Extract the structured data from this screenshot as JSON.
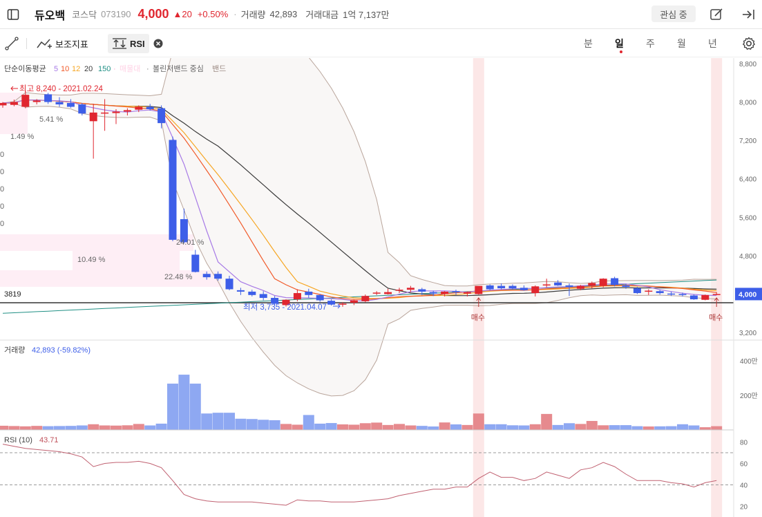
{
  "header": {
    "stock_name": "듀오백",
    "market": "코스닥",
    "code": "073190",
    "price": "4,000",
    "change": "▲20",
    "change_pct": "+0.50%",
    "separator": "·",
    "volume_label": "거래량",
    "volume": "42,893",
    "amount_label": "거래대금",
    "amount": "1억 7,137만",
    "watch_button": "관심 중"
  },
  "toolbar": {
    "indicator_label": "보조지표",
    "rsi_label": "RSI",
    "periods": [
      "분",
      "일",
      "주",
      "월",
      "년"
    ],
    "active_period": "일"
  },
  "colors": {
    "up": "#e0262f",
    "down": "#3d5ee8",
    "ma5": "#a77ae6",
    "ma10": "#f15a29",
    "ma12": "#f6a623",
    "ma20": "#3a3a3a",
    "ma150": "#1f8f84",
    "bollinger": "#b9a59b",
    "signal_band": "#fbe3e3"
  },
  "legend": {
    "title": "단순이동평균",
    "periods": [
      "5",
      "10",
      "12",
      "20",
      "150"
    ],
    "hidden_item": "매물대",
    "dot": "·",
    "bollinger": "볼린저밴드 중심",
    "band": "밴드"
  },
  "annotations": {
    "high": "최고 8,240 - 2021.02.24",
    "low": "최저 3,735 - 2021.04.07",
    "reference_price": "3819",
    "buy_label": "매수",
    "current_price": "4,000",
    "pct_labels": [
      "5.41 %",
      "1.49 %",
      "10.49 %",
      "24.01 %",
      "22.48 %"
    ],
    "partial_labels": [
      "0",
      "0",
      "0",
      "0",
      "0"
    ]
  },
  "volume_panel": {
    "title": "거래량",
    "value": "42,893 (-59.82%)",
    "ticks": [
      "400만",
      "200만"
    ]
  },
  "rsi_panel": {
    "title": "RSI (10)",
    "value": "43.71",
    "ticks": [
      "80",
      "60",
      "40",
      "20"
    ]
  },
  "chart_data": {
    "type": "candlestick",
    "price_axis": {
      "ticks": [
        8800,
        8000,
        7200,
        6400,
        5600,
        4800,
        4000,
        3200
      ],
      "tick_labels": [
        "8,800",
        "8,000",
        "7,200",
        "6,400",
        "5,600",
        "4,800",
        "4,000",
        "3,200"
      ],
      "range": [
        3200,
        8800
      ]
    },
    "volume_axis": {
      "range": [
        0,
        5000000
      ]
    },
    "rsi_axis": {
      "range": [
        10,
        90
      ],
      "dashed_levels": [
        70,
        40
      ]
    },
    "buy_signal_indices": [
      42,
      63
    ],
    "candles": [
      {
        "o": 7930,
        "h": 8000,
        "l": 7880,
        "c": 7980
      },
      {
        "o": 7940,
        "h": 8050,
        "l": 7910,
        "c": 8000
      },
      {
        "o": 7900,
        "h": 8240,
        "l": 7870,
        "c": 8150
      },
      {
        "o": 8000,
        "h": 8060,
        "l": 7950,
        "c": 8030
      },
      {
        "o": 8160,
        "h": 8190,
        "l": 7960,
        "c": 8000
      },
      {
        "o": 8000,
        "h": 8100,
        "l": 7900,
        "c": 7950
      },
      {
        "o": 7980,
        "h": 8060,
        "l": 7880,
        "c": 7900
      },
      {
        "o": 7950,
        "h": 7980,
        "l": 7720,
        "c": 7760
      },
      {
        "o": 7600,
        "h": 7960,
        "l": 6820,
        "c": 7780
      },
      {
        "o": 7770,
        "h": 8060,
        "l": 7400,
        "c": 7780
      },
      {
        "o": 7770,
        "h": 7850,
        "l": 7540,
        "c": 7800
      },
      {
        "o": 7800,
        "h": 7870,
        "l": 7720,
        "c": 7830
      },
      {
        "o": 7840,
        "h": 7930,
        "l": 7790,
        "c": 7900
      },
      {
        "o": 7900,
        "h": 7960,
        "l": 7820,
        "c": 7850
      },
      {
        "o": 7870,
        "h": 7930,
        "l": 7450,
        "c": 7560
      },
      {
        "o": 7210,
        "h": 7280,
        "l": 5100,
        "c": 5130
      },
      {
        "o": 5560,
        "h": 5780,
        "l": 5060,
        "c": 5080
      },
      {
        "o": 4820,
        "h": 4920,
        "l": 4450,
        "c": 4460
      },
      {
        "o": 4420,
        "h": 4470,
        "l": 4300,
        "c": 4350
      },
      {
        "o": 4420,
        "h": 4470,
        "l": 4280,
        "c": 4320
      },
      {
        "o": 4320,
        "h": 4380,
        "l": 4080,
        "c": 4100
      },
      {
        "o": 4080,
        "h": 4130,
        "l": 3980,
        "c": 4050
      },
      {
        "o": 4050,
        "h": 4090,
        "l": 3950,
        "c": 3980
      },
      {
        "o": 4000,
        "h": 4060,
        "l": 3870,
        "c": 3920
      },
      {
        "o": 3920,
        "h": 3960,
        "l": 3780,
        "c": 3800
      },
      {
        "o": 3770,
        "h": 3890,
        "l": 3740,
        "c": 3880
      },
      {
        "o": 3890,
        "h": 4100,
        "l": 3850,
        "c": 4020
      },
      {
        "o": 4050,
        "h": 4110,
        "l": 3920,
        "c": 3980
      },
      {
        "o": 3980,
        "h": 4000,
        "l": 3840,
        "c": 3870
      },
      {
        "o": 3860,
        "h": 3890,
        "l": 3760,
        "c": 3780
      },
      {
        "o": 3790,
        "h": 3830,
        "l": 3735,
        "c": 3800
      },
      {
        "o": 3820,
        "h": 3880,
        "l": 3770,
        "c": 3870
      },
      {
        "o": 3850,
        "h": 3990,
        "l": 3830,
        "c": 3960
      },
      {
        "o": 4010,
        "h": 4060,
        "l": 3980,
        "c": 4030
      },
      {
        "o": 4000,
        "h": 4110,
        "l": 3990,
        "c": 4040
      },
      {
        "o": 4070,
        "h": 4130,
        "l": 4020,
        "c": 4090
      },
      {
        "o": 4090,
        "h": 4170,
        "l": 4040,
        "c": 4130
      },
      {
        "o": 4100,
        "h": 4130,
        "l": 3980,
        "c": 4050
      },
      {
        "o": 4040,
        "h": 4070,
        "l": 3960,
        "c": 4010
      },
      {
        "o": 4000,
        "h": 4060,
        "l": 3950,
        "c": 4050
      },
      {
        "o": 4060,
        "h": 4090,
        "l": 3980,
        "c": 4040
      },
      {
        "o": 4010,
        "h": 4050,
        "l": 3950,
        "c": 4040
      },
      {
        "o": 4000,
        "h": 4130,
        "l": 3990,
        "c": 4170
      },
      {
        "o": 4180,
        "h": 4200,
        "l": 4080,
        "c": 4100
      },
      {
        "o": 4170,
        "h": 4220,
        "l": 4100,
        "c": 4120
      },
      {
        "o": 4170,
        "h": 4200,
        "l": 4100,
        "c": 4120
      },
      {
        "o": 4130,
        "h": 4180,
        "l": 4070,
        "c": 4080
      },
      {
        "o": 4020,
        "h": 4180,
        "l": 3950,
        "c": 4160
      },
      {
        "o": 4180,
        "h": 4320,
        "l": 4140,
        "c": 4200
      },
      {
        "o": 4240,
        "h": 4290,
        "l": 4170,
        "c": 4180
      },
      {
        "o": 4180,
        "h": 4220,
        "l": 3960,
        "c": 4150
      },
      {
        "o": 4110,
        "h": 4190,
        "l": 4080,
        "c": 4170
      },
      {
        "o": 4170,
        "h": 4260,
        "l": 4120,
        "c": 4230
      },
      {
        "o": 4170,
        "h": 4330,
        "l": 4140,
        "c": 4320
      },
      {
        "o": 4330,
        "h": 4360,
        "l": 4160,
        "c": 4190
      },
      {
        "o": 4180,
        "h": 4210,
        "l": 4110,
        "c": 4150
      },
      {
        "o": 4120,
        "h": 4150,
        "l": 4000,
        "c": 4020
      },
      {
        "o": 4050,
        "h": 4100,
        "l": 3980,
        "c": 4070
      },
      {
        "o": 4060,
        "h": 4090,
        "l": 3990,
        "c": 4020
      },
      {
        "o": 4010,
        "h": 4050,
        "l": 3960,
        "c": 4000
      },
      {
        "o": 4000,
        "h": 4030,
        "l": 3950,
        "c": 3980
      },
      {
        "o": 3970,
        "h": 3990,
        "l": 3880,
        "c": 3890
      },
      {
        "o": 3880,
        "h": 3990,
        "l": 3870,
        "c": 3980
      },
      {
        "o": 3990,
        "h": 4040,
        "l": 3980,
        "c": 4000
      }
    ],
    "volume": [
      280,
      260,
      240,
      270,
      250,
      260,
      270,
      300,
      380,
      300,
      290,
      310,
      400,
      300,
      420,
      3100,
      3700,
      3100,
      1100,
      1150,
      1150,
      750,
      730,
      680,
      650,
      400,
      350,
      1000,
      420,
      460,
      370,
      350,
      450,
      490,
      330,
      400,
      300,
      270,
      230,
      500,
      370,
      330,
      1100,
      380,
      380,
      310,
      300,
      380,
      1070,
      330,
      450,
      400,
      600,
      310,
      320,
      320,
      250,
      230,
      240,
      250,
      380,
      300,
      180,
      250
    ],
    "rsi": [
      78,
      76,
      74,
      73,
      72,
      71,
      69,
      66,
      57,
      60,
      61,
      61,
      62,
      60,
      56,
      44,
      31,
      27,
      25,
      24,
      24,
      24,
      24,
      23,
      22,
      21,
      26,
      25,
      25,
      24,
      24,
      24,
      25,
      26,
      27,
      30,
      32,
      34,
      36,
      36,
      38,
      38,
      46,
      52,
      47,
      47,
      44,
      46,
      52,
      49,
      46,
      54,
      56,
      61,
      57,
      50,
      44,
      44,
      44,
      42,
      41,
      38,
      42,
      44
    ]
  }
}
